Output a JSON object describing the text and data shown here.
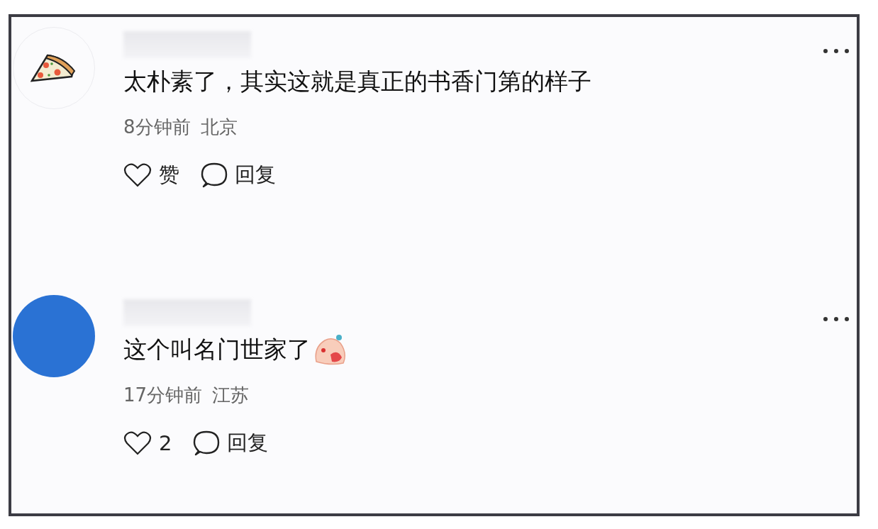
{
  "comments": [
    {
      "avatar": {
        "kind": "pizza"
      },
      "text": "太朴素了，其实这就是真正的书香门第的样子",
      "emoji": false,
      "time": "8分钟前",
      "location": "北京",
      "like": {
        "label": "赞"
      },
      "reply": {
        "label": "回复"
      }
    },
    {
      "avatar": {
        "kind": "plain",
        "color": "#2a72d4"
      },
      "text": "这个叫名门世家了",
      "emoji": true,
      "time": "17分钟前",
      "location": "江苏",
      "like": {
        "label": "2"
      },
      "reply": {
        "label": "回复"
      }
    }
  ]
}
